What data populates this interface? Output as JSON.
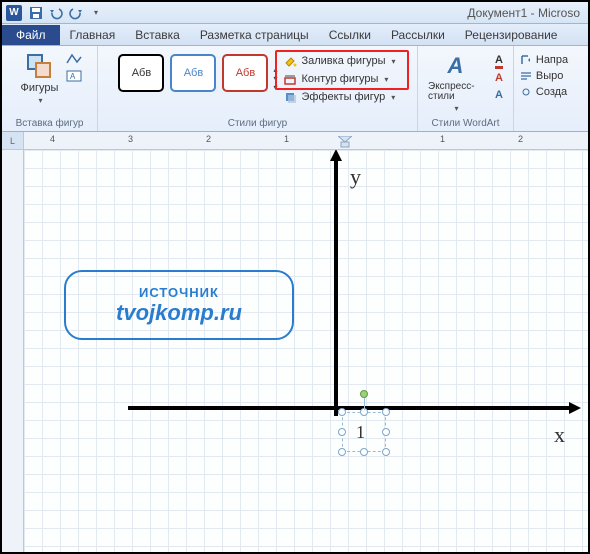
{
  "title": "Документ1 - Microso",
  "tabs": {
    "file": "Файл",
    "home": "Главная",
    "insert": "Вставка",
    "layout": "Разметка страницы",
    "references": "Ссылки",
    "mailings": "Рассылки",
    "review": "Рецензирование"
  },
  "ribbon": {
    "group_insert_shapes": "Вставка фигур",
    "shapes_btn": "Фигуры",
    "group_shape_styles": "Стили фигур",
    "style_sample": "Абв",
    "shape_fill": "Заливка фигуры",
    "shape_outline": "Контур фигуры",
    "shape_effects": "Эффекты фигур",
    "group_wordart": "Стили WordArt",
    "express_styles": "Экспресс-стили",
    "direction": "Напра",
    "align": "Выро",
    "create": "Созда"
  },
  "ruler": {
    "corner": "L",
    "labels": [
      "4",
      "3",
      "2",
      "1",
      "1",
      "2"
    ]
  },
  "canvas": {
    "axis_x_label": "x",
    "axis_y_label": "y",
    "unit_label": "1",
    "source_label1": "ИСТОЧНИК",
    "source_label2": "tvojkomp.ru"
  }
}
